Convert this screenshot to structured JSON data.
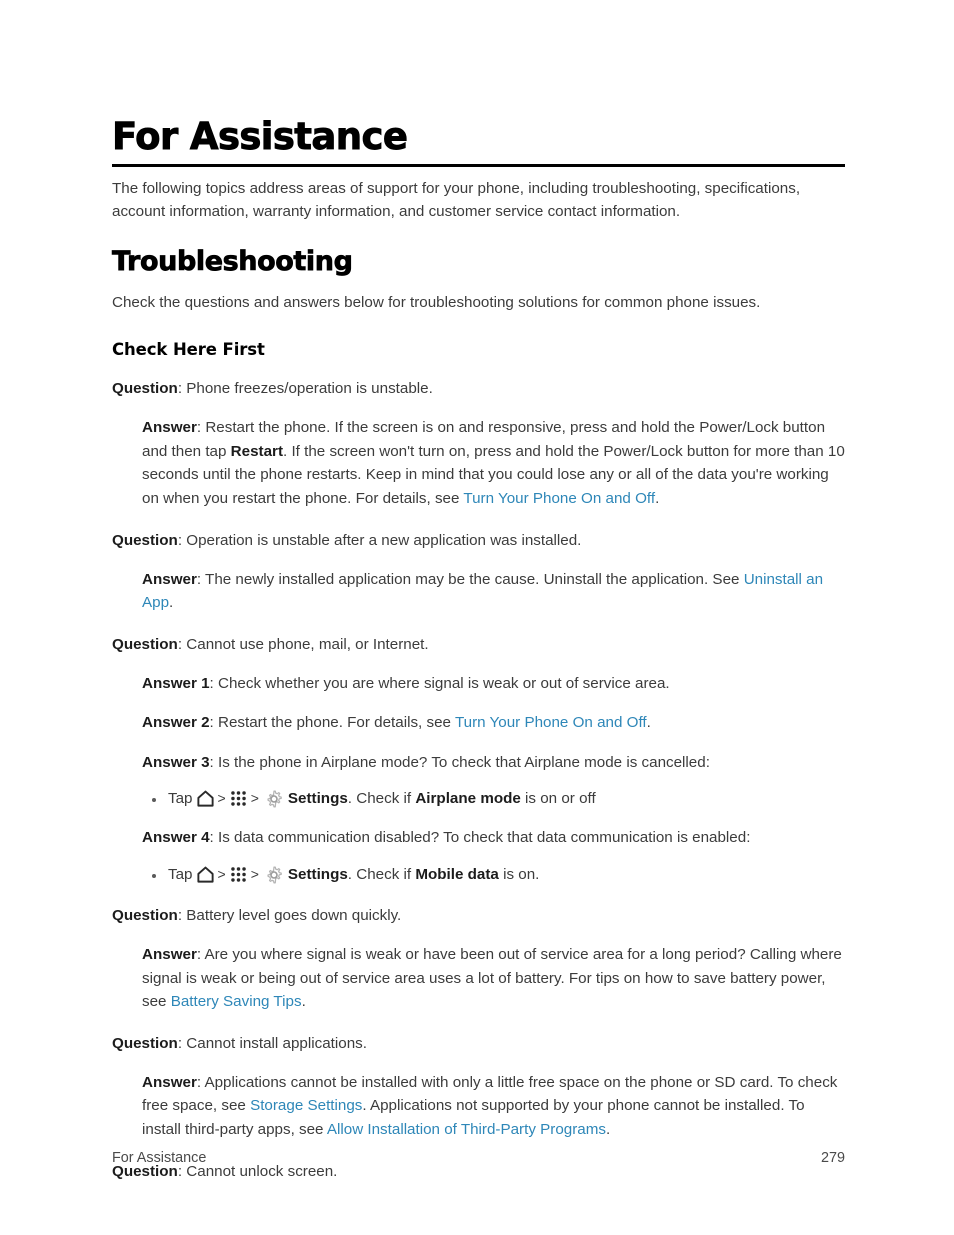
{
  "document": {
    "title": "For Assistance",
    "intro": "The following topics address areas of support for your phone, including troubleshooting, specifications, account information, warranty information, and customer service contact information.",
    "section_heading": "Troubleshooting",
    "section_intro": "Check the questions and answers below for troubleshooting solutions for common phone issues.",
    "sub_heading": "Check Here First"
  },
  "labels": {
    "question": "Question",
    "answer": "Answer",
    "answer1": "Answer 1",
    "answer2": "Answer 2",
    "answer3": "Answer 3",
    "answer4": "Answer 4",
    "colon": ": ",
    "period": ".",
    "chevron": ">"
  },
  "qa": {
    "q1": {
      "question_text": "Phone freezes/operation is unstable.",
      "answer_part1": "Restart the phone. If the screen is on and responsive, press and hold the Power/Lock button and then tap ",
      "answer_bold": "Restart",
      "answer_part2": ". If the screen won't turn on, press and hold the Power/Lock button for more than 10 seconds until the phone restarts. Keep in mind that you could lose any or all of the data you're working on when you restart the phone. For details, see ",
      "answer_link": "Turn Your Phone On and Off"
    },
    "q2": {
      "question_text": "Operation is unstable after a new application was installed.",
      "answer_part1": "The newly installed application may be the cause. Uninstall the application. See ",
      "answer_link": "Uninstall an App"
    },
    "q3": {
      "question_text": "Cannot use phone, mail, or Internet.",
      "answer1_text": "Check whether you are where signal is weak or out of service area.",
      "answer2_part1": "Restart the phone. For details, see ",
      "answer2_link": "Turn Your Phone On and Off",
      "answer3_text": "Is the phone in Airplane mode? To check that Airplane mode is cancelled:",
      "answer3_step": {
        "tap": "Tap",
        "settings": "Settings",
        "check_prefix": ". Check if ",
        "feature": "Airplane mode",
        "check_suffix": " is on or off"
      },
      "answer4_text": "Is data communication disabled? To check that data communication is enabled:",
      "answer4_step": {
        "tap": "Tap",
        "settings": "Settings",
        "check_prefix": ". Check if ",
        "feature": "Mobile data",
        "check_suffix": " is on."
      }
    },
    "q4": {
      "question_text": "Battery level goes down quickly.",
      "answer_part1": "Are you where signal is weak or have been out of service area for a long period? Calling where signal is weak or being out of service area uses a lot of battery. For tips on how to save battery power, see ",
      "answer_link": "Battery Saving Tips"
    },
    "q5": {
      "question_text": "Cannot install applications.",
      "answer_part1": "Applications cannot be installed with only a little free space on the phone or SD card. To check free space, see ",
      "answer_link1": "Storage Settings",
      "answer_part2": ". Applications not supported by your phone cannot be installed. To install third-party apps, see ",
      "answer_link2": "Allow Installation of Third-Party Programs"
    },
    "q6": {
      "question_text": "Cannot unlock screen."
    }
  },
  "footer": {
    "left": "For Assistance",
    "page_number": "279"
  },
  "icons": {
    "home": "home-icon",
    "apps": "apps-grid-icon",
    "settings": "gear-icon"
  },
  "colors": {
    "link": "#2e87b8",
    "body_text": "#3c3c3c",
    "heading": "#000000"
  }
}
